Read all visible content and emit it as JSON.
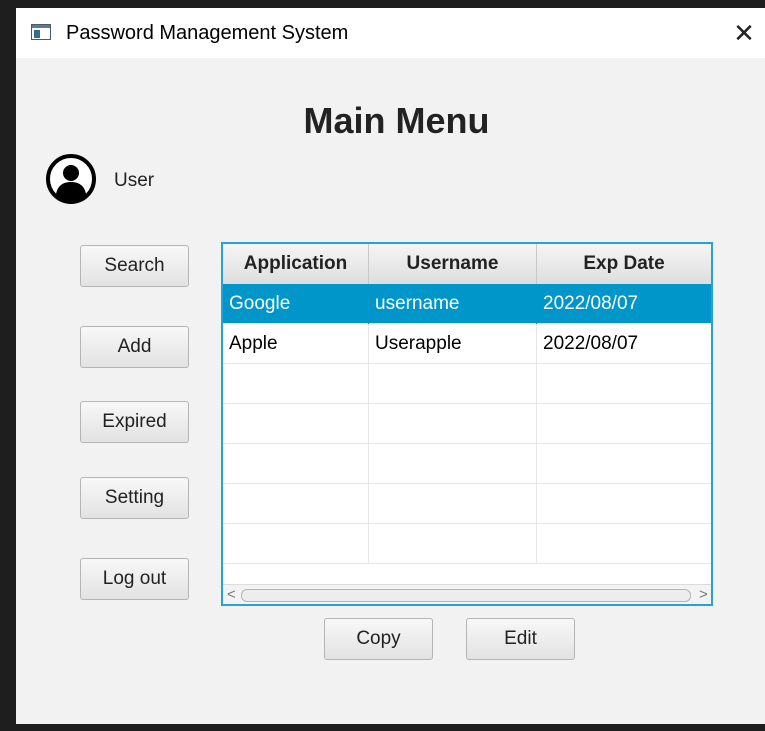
{
  "window": {
    "title": "Password Management System",
    "close_glyph": "✕"
  },
  "main": {
    "heading": "Main Menu",
    "user_label": "User",
    "avatar_icon": "user-circle-icon"
  },
  "sidebar": {
    "buttons": [
      {
        "label": "Search"
      },
      {
        "label": "Add"
      },
      {
        "label": "Expired"
      },
      {
        "label": "Setting"
      },
      {
        "label": "Log out"
      }
    ]
  },
  "table": {
    "columns": [
      "Application",
      "Username",
      "Exp Date"
    ],
    "rows": [
      {
        "application": "Google",
        "username": "username",
        "exp_date": "2022/08/07",
        "selected": true
      },
      {
        "application": "Apple",
        "username": "Userapple",
        "exp_date": "2022/08/07",
        "selected": false
      }
    ],
    "empty_rows": 5,
    "scroll_left_glyph": "<",
    "scroll_right_glyph": ">"
  },
  "actions": {
    "copy_label": "Copy",
    "edit_label": "Edit"
  },
  "colors": {
    "accent": "#2aa1d3",
    "selection": "#0096c9"
  }
}
